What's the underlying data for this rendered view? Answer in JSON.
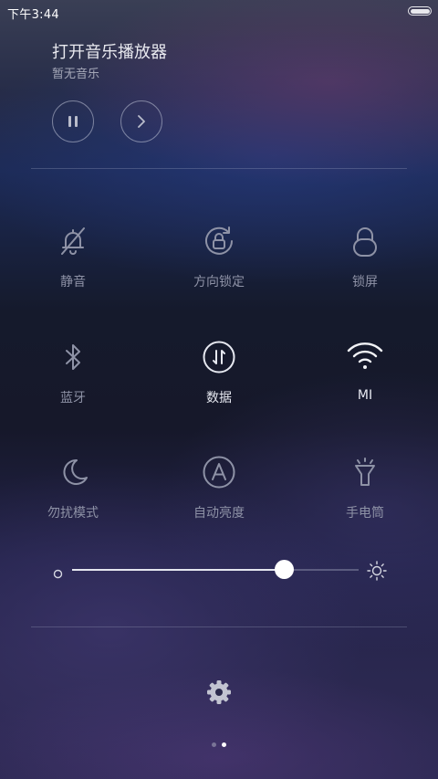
{
  "status_bar": {
    "time": "下午3:44",
    "battery_icon": "battery-icon"
  },
  "music": {
    "title": "打开音乐播放器",
    "subtitle": "暂无音乐",
    "pause_icon": "pause-icon",
    "next_icon": "next-icon"
  },
  "toggles": [
    {
      "label": "静音",
      "icon": "bell-off-icon",
      "active": false
    },
    {
      "label": "方向锁定",
      "icon": "rotation-lock-icon",
      "active": false
    },
    {
      "label": "锁屏",
      "icon": "lock-icon",
      "active": false
    },
    {
      "label": "蓝牙",
      "icon": "bluetooth-icon",
      "active": false
    },
    {
      "label": "数据",
      "icon": "mobile-data-icon",
      "active": true
    },
    {
      "label": "MI",
      "icon": "wifi-icon",
      "active": true
    },
    {
      "label": "勿扰模式",
      "icon": "moon-icon",
      "active": false
    },
    {
      "label": "自动亮度",
      "icon": "auto-brightness-icon",
      "active": false
    },
    {
      "label": "手电筒",
      "icon": "flashlight-icon",
      "active": false
    }
  ],
  "brightness": {
    "level": 0.74,
    "min_icon": "brightness-low-icon",
    "max_icon": "brightness-high-icon"
  },
  "settings_icon": "gear-icon",
  "pager": {
    "count": 2,
    "current": 2
  },
  "colors": {
    "active": "#e6e8f0",
    "inactive": "#8e92a6",
    "accent_white": "#ffffff"
  }
}
